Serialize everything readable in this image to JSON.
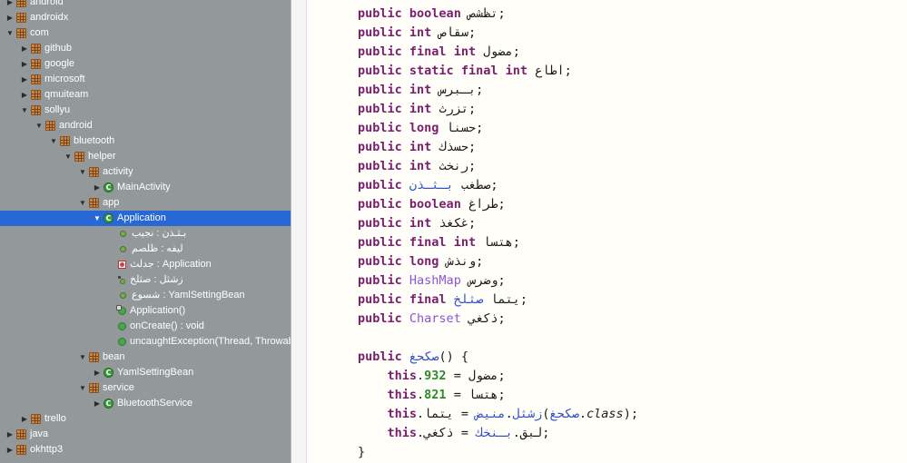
{
  "tree": {
    "rows": [
      {
        "label": "android",
        "kind": "package",
        "depth": 0,
        "arrow": "collapsed"
      },
      {
        "label": "androidx",
        "kind": "package",
        "depth": 0,
        "arrow": "collapsed"
      },
      {
        "label": "com",
        "kind": "package",
        "depth": 0,
        "arrow": "expanded"
      },
      {
        "label": "github",
        "kind": "package",
        "depth": 1,
        "arrow": "collapsed"
      },
      {
        "label": "google",
        "kind": "package",
        "depth": 1,
        "arrow": "collapsed"
      },
      {
        "label": "microsoft",
        "kind": "package",
        "depth": 1,
        "arrow": "collapsed"
      },
      {
        "label": "qmuiteam",
        "kind": "package",
        "depth": 1,
        "arrow": "collapsed"
      },
      {
        "label": "sollyu",
        "kind": "package",
        "depth": 1,
        "arrow": "expanded"
      },
      {
        "label": "android",
        "kind": "package",
        "depth": 2,
        "arrow": "expanded"
      },
      {
        "label": "bluetooth",
        "kind": "package",
        "depth": 3,
        "arrow": "expanded"
      },
      {
        "label": "helper",
        "kind": "package",
        "depth": 4,
        "arrow": "expanded"
      },
      {
        "label": "activity",
        "kind": "package",
        "depth": 5,
        "arrow": "expanded"
      },
      {
        "label": "MainActivity",
        "kind": "class",
        "depth": 6,
        "arrow": "collapsed"
      },
      {
        "label": "app",
        "kind": "package",
        "depth": 5,
        "arrow": "expanded"
      },
      {
        "label": "Application",
        "kind": "class",
        "depth": 6,
        "arrow": "expanded",
        "selected": true
      },
      {
        "label": "بـثـذن : نجيب",
        "kind": "field",
        "depth": 7,
        "arrow": "none"
      },
      {
        "label": "ليفه : ظلصم",
        "kind": "field",
        "depth": 7,
        "arrow": "none"
      },
      {
        "label": "جدلث : Application",
        "kind": "static-field",
        "depth": 7,
        "arrow": "none"
      },
      {
        "label": "زشثل : صثلخ",
        "kind": "setter",
        "depth": 7,
        "arrow": "none"
      },
      {
        "label": "شسوع : YamlSettingBean",
        "kind": "field",
        "depth": 7,
        "arrow": "none"
      },
      {
        "label": "Application()",
        "kind": "constructor",
        "depth": 7,
        "arrow": "none"
      },
      {
        "label": "onCreate() : void",
        "kind": "method",
        "depth": 7,
        "arrow": "none"
      },
      {
        "label": "uncaughtException(Thread, Throwable) : void",
        "kind": "method",
        "depth": 7,
        "arrow": "none"
      },
      {
        "label": "bean",
        "kind": "package",
        "depth": 5,
        "arrow": "expanded"
      },
      {
        "label": "YamlSettingBean",
        "kind": "class",
        "depth": 6,
        "arrow": "collapsed"
      },
      {
        "label": "service",
        "kind": "package",
        "depth": 5,
        "arrow": "expanded"
      },
      {
        "label": "BluetoothService",
        "kind": "class",
        "depth": 6,
        "arrow": "collapsed"
      },
      {
        "label": "trello",
        "kind": "package",
        "depth": 1,
        "arrow": "collapsed"
      },
      {
        "label": "java",
        "kind": "package",
        "depth": 0,
        "arrow": "collapsed"
      },
      {
        "label": "okhttp3",
        "kind": "package",
        "depth": 0,
        "arrow": "collapsed"
      }
    ]
  },
  "code": {
    "lines": [
      [
        [
          "kw",
          "public"
        ],
        [
          "sp",
          " "
        ],
        [
          "kw",
          "boolean"
        ],
        [
          "sp",
          " "
        ],
        [
          "ident",
          "تظشص"
        ],
        [
          "punct",
          ";"
        ]
      ],
      [
        [
          "kw",
          "public"
        ],
        [
          "sp",
          " "
        ],
        [
          "kw",
          "int"
        ],
        [
          "sp",
          " "
        ],
        [
          "ident",
          "سقاص"
        ],
        [
          "punct",
          ";"
        ]
      ],
      [
        [
          "kw",
          "public"
        ],
        [
          "sp",
          " "
        ],
        [
          "kw",
          "final"
        ],
        [
          "sp",
          " "
        ],
        [
          "kw",
          "int"
        ],
        [
          "sp",
          " "
        ],
        [
          "ident",
          "مضول"
        ],
        [
          "punct",
          ";"
        ]
      ],
      [
        [
          "kw",
          "public"
        ],
        [
          "sp",
          " "
        ],
        [
          "kw",
          "static"
        ],
        [
          "sp",
          " "
        ],
        [
          "kw",
          "final"
        ],
        [
          "sp",
          " "
        ],
        [
          "kw",
          "int"
        ],
        [
          "sp",
          " "
        ],
        [
          "ident",
          "اطاع"
        ],
        [
          "punct",
          ";"
        ]
      ],
      [
        [
          "kw",
          "public"
        ],
        [
          "sp",
          " "
        ],
        [
          "kw",
          "int"
        ],
        [
          "sp",
          " "
        ],
        [
          "ident",
          "بـبرس"
        ],
        [
          "punct",
          ";"
        ]
      ],
      [
        [
          "kw",
          "public"
        ],
        [
          "sp",
          " "
        ],
        [
          "kw",
          "int"
        ],
        [
          "sp",
          " "
        ],
        [
          "ident",
          "تزرث"
        ],
        [
          "punct",
          ";"
        ]
      ],
      [
        [
          "kw",
          "public"
        ],
        [
          "sp",
          " "
        ],
        [
          "kw",
          "long"
        ],
        [
          "sp",
          " "
        ],
        [
          "ident",
          "حسنا"
        ],
        [
          "punct",
          ";"
        ]
      ],
      [
        [
          "kw",
          "public"
        ],
        [
          "sp",
          " "
        ],
        [
          "kw",
          "int"
        ],
        [
          "sp",
          " "
        ],
        [
          "ident",
          "حسذك"
        ],
        [
          "punct",
          ";"
        ]
      ],
      [
        [
          "kw",
          "public"
        ],
        [
          "sp",
          " "
        ],
        [
          "kw",
          "int"
        ],
        [
          "sp",
          " "
        ],
        [
          "ident",
          "رنخث"
        ],
        [
          "punct",
          ";"
        ]
      ],
      [
        [
          "kw",
          "public"
        ],
        [
          "sp",
          " "
        ],
        [
          "ident",
          "صطغب"
        ],
        [
          "sp",
          " "
        ],
        [
          "ident-blue",
          "بـثـذن"
        ],
        [
          "punct",
          ";"
        ]
      ],
      [
        [
          "kw",
          "public"
        ],
        [
          "sp",
          " "
        ],
        [
          "kw",
          "boolean"
        ],
        [
          "sp",
          " "
        ],
        [
          "ident",
          "طراغ"
        ],
        [
          "punct",
          ";"
        ]
      ],
      [
        [
          "kw",
          "public"
        ],
        [
          "sp",
          " "
        ],
        [
          "kw",
          "int"
        ],
        [
          "sp",
          " "
        ],
        [
          "ident",
          "غكغذ"
        ],
        [
          "punct",
          ";"
        ]
      ],
      [
        [
          "kw",
          "public"
        ],
        [
          "sp",
          " "
        ],
        [
          "kw",
          "final"
        ],
        [
          "sp",
          " "
        ],
        [
          "kw",
          "int"
        ],
        [
          "sp",
          " "
        ],
        [
          "ident",
          "هتسا"
        ],
        [
          "punct",
          ";"
        ]
      ],
      [
        [
          "kw",
          "public"
        ],
        [
          "sp",
          " "
        ],
        [
          "kw",
          "long"
        ],
        [
          "sp",
          " "
        ],
        [
          "ident",
          "ونذش"
        ],
        [
          "punct",
          ";"
        ]
      ],
      [
        [
          "kw",
          "public"
        ],
        [
          "sp",
          " "
        ],
        [
          "type",
          "HashMap"
        ],
        [
          "sp",
          " "
        ],
        [
          "ident",
          "وضرس"
        ],
        [
          "punct",
          ";"
        ]
      ],
      [
        [
          "kw",
          "public"
        ],
        [
          "sp",
          " "
        ],
        [
          "kw",
          "final"
        ],
        [
          "sp",
          " "
        ],
        [
          "ident",
          "يتما"
        ],
        [
          "sp",
          " "
        ],
        [
          "ident-blue",
          "صثلخ"
        ],
        [
          "punct",
          ";"
        ]
      ],
      [
        [
          "kw",
          "public"
        ],
        [
          "sp",
          " "
        ],
        [
          "type",
          "Charset"
        ],
        [
          "sp",
          " "
        ],
        [
          "ident",
          "ذكغي"
        ],
        [
          "punct",
          ";"
        ]
      ],
      [],
      [
        [
          "kw",
          "public"
        ],
        [
          "sp",
          " "
        ],
        [
          "ident-blue",
          "صكحغ"
        ],
        [
          "punct",
          "() {"
        ]
      ],
      [
        [
          "sp",
          "    "
        ],
        [
          "kw",
          "this"
        ],
        [
          "punct",
          "."
        ],
        [
          "num",
          "932"
        ],
        [
          "punct",
          " = "
        ],
        [
          "ident",
          "مضول"
        ],
        [
          "punct",
          ";"
        ]
      ],
      [
        [
          "sp",
          "    "
        ],
        [
          "kw",
          "this"
        ],
        [
          "punct",
          "."
        ],
        [
          "num",
          "821"
        ],
        [
          "punct",
          " = "
        ],
        [
          "ident",
          "هتسا"
        ],
        [
          "punct",
          ";"
        ]
      ],
      [
        [
          "sp",
          "    "
        ],
        [
          "kw",
          "this"
        ],
        [
          "punct",
          "."
        ],
        [
          "ident-blue",
          "زشثل"
        ],
        [
          "punct",
          "."
        ],
        [
          "ident-blue",
          "منيض"
        ],
        [
          "punct",
          " = "
        ],
        [
          "ident",
          "يتما"
        ],
        [
          "punct",
          "("
        ],
        [
          "ident-blue",
          "صكحغ"
        ],
        [
          "punct",
          "."
        ],
        [
          "italic",
          "class"
        ],
        [
          "punct",
          ");"
        ]
      ],
      [
        [
          "sp",
          "    "
        ],
        [
          "kw",
          "this"
        ],
        [
          "punct",
          "."
        ],
        [
          "ident",
          "لبق"
        ],
        [
          "punct",
          "."
        ],
        [
          "ident-blue",
          "بـنخك"
        ],
        [
          "punct",
          " = "
        ],
        [
          "ident",
          "ذكغي"
        ],
        [
          "punct",
          ";"
        ]
      ],
      [
        [
          "punct",
          "}"
        ]
      ]
    ]
  },
  "colors": {
    "tree_background": "#93999b",
    "selection": "#2868d6",
    "keyword": "#7a1d6f",
    "type": "#8a55d4",
    "number": "#2a8a2a",
    "field_ref": "#3050c8"
  },
  "icons": {
    "package": "package-icon",
    "class": "class-icon",
    "field": "field-icon",
    "static-field": "static-field-icon",
    "setter": "setter-field-icon",
    "constructor": "constructor-icon",
    "method": "method-icon"
  }
}
